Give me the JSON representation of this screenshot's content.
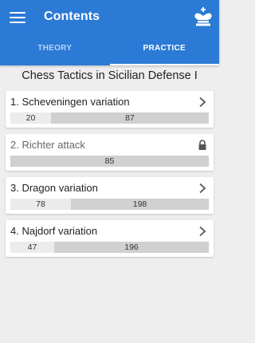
{
  "appbar": {
    "title": "Contents",
    "menu_icon": "hamburger-menu-icon",
    "logo_icon": "chess-king-logo-icon",
    "color": "#2b7ad6"
  },
  "tabs": [
    {
      "label": "THEORY",
      "active": false
    },
    {
      "label": "PRACTICE",
      "active": true
    }
  ],
  "heading": "Chess Tactics in Sicilian Defense I",
  "items": [
    {
      "label": "1. Scheveningen variation",
      "icon": "chevron-right-icon",
      "locked": false,
      "left": "20",
      "right": "87"
    },
    {
      "label": "2. Richter attack",
      "icon": "lock-icon",
      "locked": true,
      "left": "",
      "right": "85"
    },
    {
      "label": "3. Dragon variation",
      "icon": "chevron-right-icon",
      "locked": false,
      "left": "78",
      "right": "198"
    },
    {
      "label": "4. Najdorf variation",
      "icon": "chevron-right-icon",
      "locked": false,
      "left": "47",
      "right": "196"
    }
  ]
}
